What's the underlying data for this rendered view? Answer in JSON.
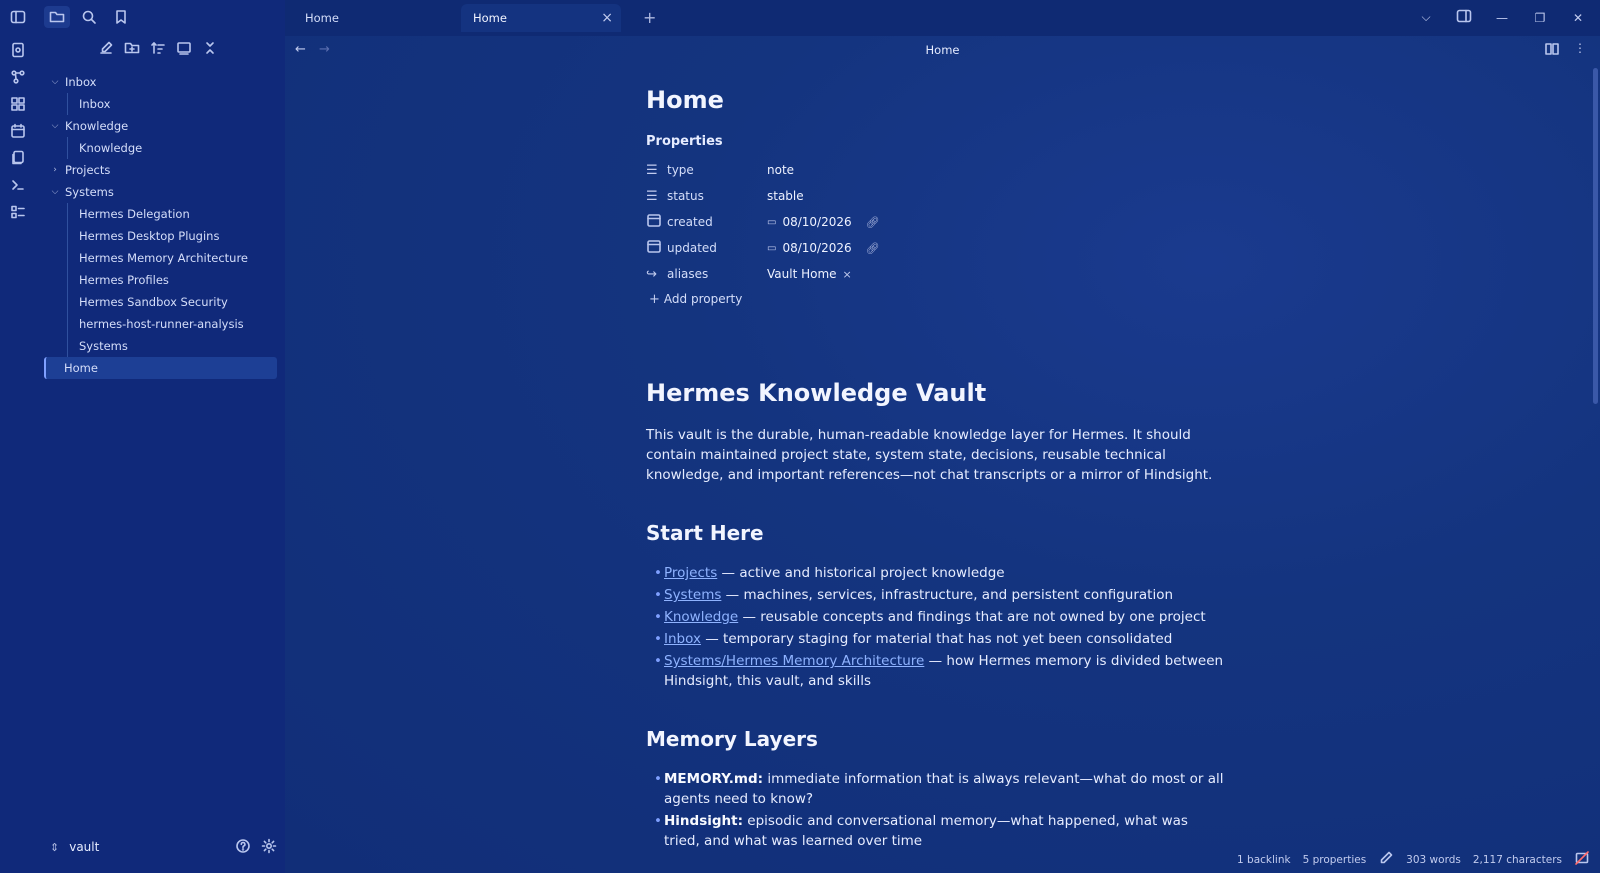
{
  "sidebar": {
    "tree": [
      {
        "label": "Inbox",
        "level": 0,
        "expanded": true
      },
      {
        "label": "Inbox",
        "level": 1
      },
      {
        "label": "Knowledge",
        "level": 0,
        "expanded": true
      },
      {
        "label": "Knowledge",
        "level": 1
      },
      {
        "label": "Projects",
        "level": 0,
        "expanded": false
      },
      {
        "label": "Systems",
        "level": 0,
        "expanded": true
      },
      {
        "label": "Hermes Delegation",
        "level": 1
      },
      {
        "label": "Hermes Desktop Plugins",
        "level": 1
      },
      {
        "label": "Hermes Memory Architecture",
        "level": 1
      },
      {
        "label": "Hermes Profiles",
        "level": 1
      },
      {
        "label": "Hermes Sandbox Security",
        "level": 1
      },
      {
        "label": "hermes-host-runner-analysis",
        "level": 1
      },
      {
        "label": "Systems",
        "level": 1
      },
      {
        "label": "Home",
        "level": 0,
        "selected": true
      }
    ],
    "vault_name": "vault"
  },
  "tabs": [
    {
      "label": "Home",
      "active": false
    },
    {
      "label": "Home",
      "active": true
    }
  ],
  "nav": {
    "title": "Home"
  },
  "note": {
    "title": "Home",
    "properties_heading": "Properties",
    "properties": [
      {
        "icon": "text-icon",
        "key": "type",
        "value": "note"
      },
      {
        "icon": "text-icon",
        "key": "status",
        "value": "stable"
      },
      {
        "icon": "calendar-icon",
        "key": "created",
        "value": "08/10/2026"
      },
      {
        "icon": "calendar-icon",
        "key": "updated",
        "value": "08/10/2026"
      },
      {
        "icon": "alias-icon",
        "key": "aliases",
        "value": "Vault Home"
      }
    ],
    "add_property": "Add property",
    "h1": "Hermes Knowledge Vault",
    "intro": "This vault is the durable, human-readable knowledge layer for Hermes. It should contain maintained project state, system state, decisions, reusable technical knowledge, and important references—not chat transcripts or a mirror of Hindsight.",
    "start_heading": "Start Here",
    "start_items": [
      {
        "link": "Projects",
        "text": " — active and historical project knowledge"
      },
      {
        "link": "Systems",
        "text": " — machines, services, infrastructure, and persistent configuration"
      },
      {
        "link": "Knowledge",
        "text": " — reusable concepts and findings that are not owned by one project"
      },
      {
        "link": "Inbox",
        "text": " — temporary staging for material that has not yet been consolidated"
      },
      {
        "link": "Systems/Hermes Memory Architecture",
        "text": " — how Hermes memory is divided between Hindsight, this vault, and skills"
      }
    ],
    "memory_heading": "Memory Layers",
    "memory_items": [
      {
        "bold": "MEMORY.md:",
        "text": " immediate information that is always relevant—what do most or all agents need to know?"
      },
      {
        "bold": "Hindsight:",
        "text": " episodic and conversational memory—what happened, what was tried, and what was learned over time"
      }
    ]
  },
  "status": {
    "backlinks": "1 backlink",
    "properties": "5 properties",
    "words": "303 words",
    "characters": "2,117 characters"
  }
}
